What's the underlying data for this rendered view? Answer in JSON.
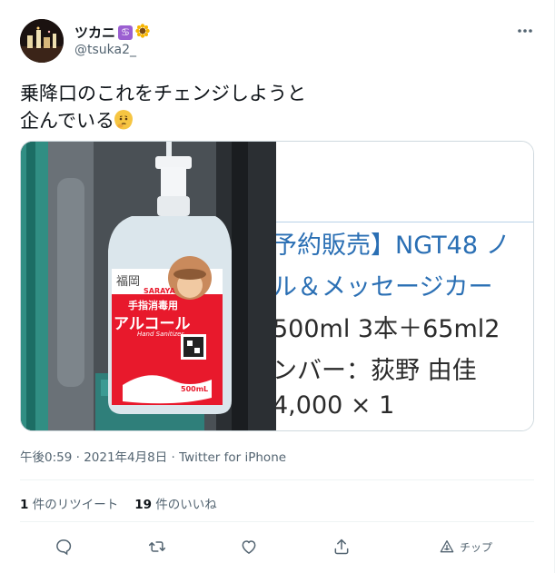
{
  "user": {
    "display_name": "ツカニ",
    "handle": "@tsuka2_",
    "badge_icons": [
      "cancer-zodiac-icon",
      "sunflower-icon"
    ]
  },
  "tweet": {
    "text": "乗降口のこれをチェンジしようと\n企んでいる",
    "emoji": "thinking-face-icon"
  },
  "media": {
    "left_photo": {
      "prefecture_label": "福岡",
      "bottle_heading": "手指消毒用",
      "bottle_title": "アルコール",
      "bottle_sub": "Hand Sanitizer",
      "bottle_volume": "500mL",
      "bottle_brand": "SARAYA"
    },
    "right_photo_lines": [
      "予約販売】NGT48 ノ",
      "ル＆メッセージカー",
      "500ml 3本＋65ml2",
      "ンバー：荻野 由佳",
      "4,000 × 1"
    ]
  },
  "meta": {
    "timestamp": "午後0:59 · 2021年4月8日 · Twitter for iPhone"
  },
  "stats": {
    "retweet_count": "1",
    "retweet_label": "件のリツイート",
    "like_count": "19",
    "like_label": "件のいいね"
  },
  "actions": {
    "tip_label": "チップ"
  },
  "colors": {
    "accent_blue": "#2a6fb4",
    "muted": "#536471",
    "bottle_red": "#e8192c"
  }
}
